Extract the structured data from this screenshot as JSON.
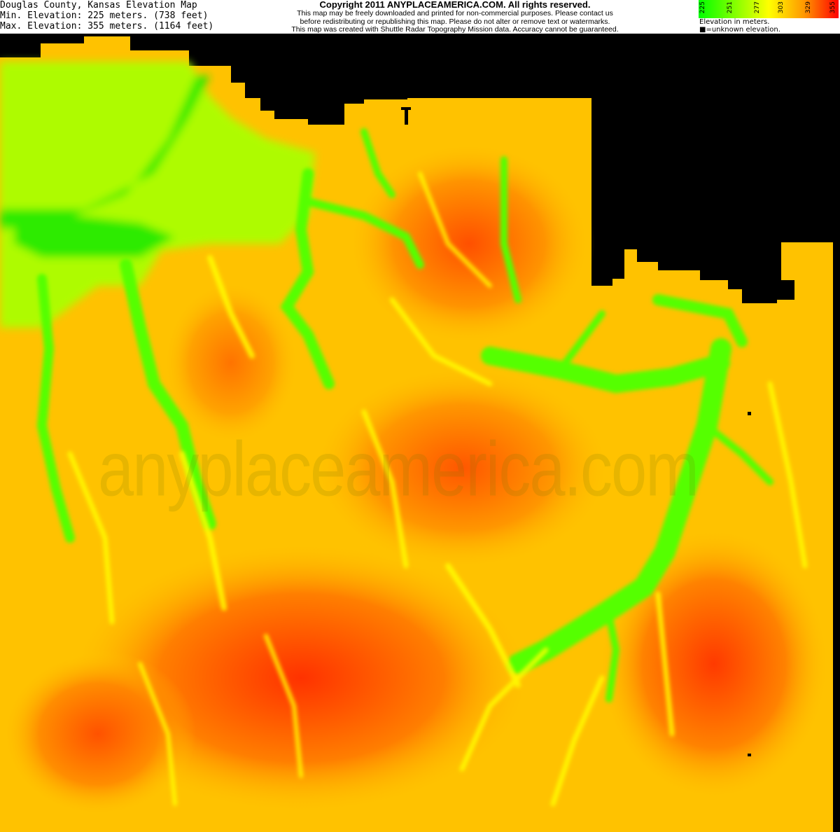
{
  "header": {
    "title": "Douglas County, Kansas Elevation Map",
    "min_elevation": "Min. Elevation: 225 meters. (738 feet)",
    "max_elevation": "Max. Elevation: 355 meters. (1164 feet)"
  },
  "copyright": {
    "title": "Copyright 2011 ANYPLACEAMERICA.COM.  All rights reserved.",
    "line1": "This map may be freely downloaded and printed for non-commercial purposes.  Please contact us",
    "line2": "before redistributing or republishing this map.  Please do not alter or remove text or watermarks.",
    "line3": "This map was created with Shuttle Radar Topography Mission data.  Accuracy cannot be guaranteed."
  },
  "legend": {
    "ticks": [
      "225",
      "251",
      "277",
      "303",
      "329",
      "355"
    ],
    "note1": "Elevation in meters.",
    "note2": "■=unknown elevation.",
    "colors": [
      "#00ff00",
      "#7fff00",
      "#ffff00",
      "#ff9900",
      "#ff0000"
    ]
  },
  "watermark": "anyplaceamerica.com",
  "colors": {
    "low": "#00ff00",
    "mid_low": "#99ff00",
    "mid": "#ffff00",
    "mid_high": "#ff9900",
    "high": "#ff2200",
    "unknown": "#000000"
  }
}
